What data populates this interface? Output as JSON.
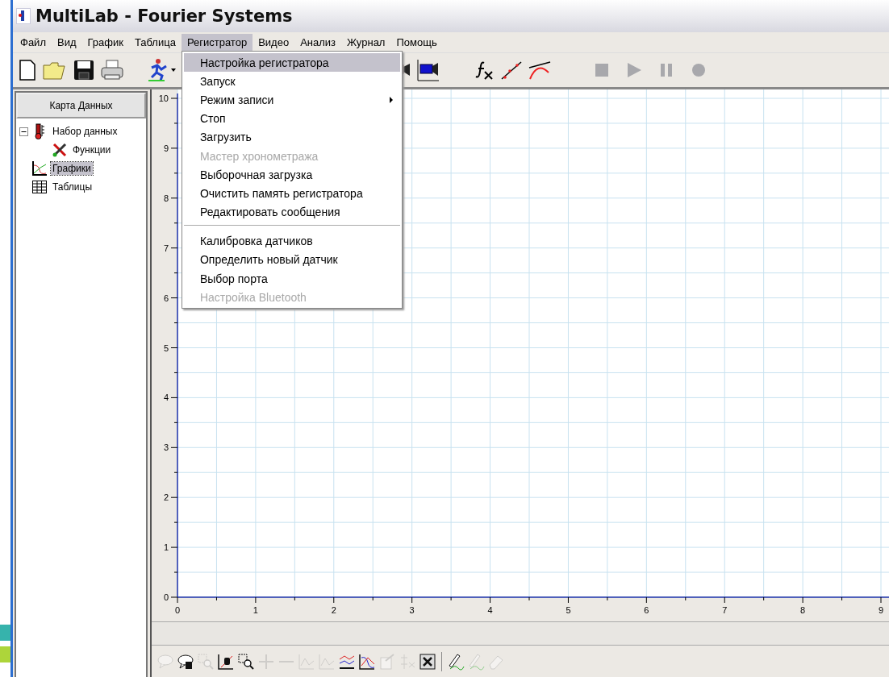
{
  "window": {
    "title": "MultiLab - Fourier Systems"
  },
  "menu_bar": [
    {
      "label": "Файл",
      "selected": false
    },
    {
      "label": "Вид",
      "selected": false
    },
    {
      "label": "График",
      "selected": false
    },
    {
      "label": "Таблица",
      "selected": false
    },
    {
      "label": "Регистратор",
      "selected": true
    },
    {
      "label": "Видео",
      "selected": false
    },
    {
      "label": "Анализ",
      "selected": false
    },
    {
      "label": "Журнал",
      "selected": false
    },
    {
      "label": "Помощь",
      "selected": false
    }
  ],
  "dropdown": [
    {
      "label": "Настройка регистратора",
      "selected": true,
      "disabled": false,
      "submenu": false
    },
    {
      "label": "Запуск",
      "selected": false,
      "disabled": false,
      "submenu": false
    },
    {
      "label": "Режим записи",
      "selected": false,
      "disabled": false,
      "submenu": true
    },
    {
      "label": "Стоп",
      "selected": false,
      "disabled": false,
      "submenu": false
    },
    {
      "label": "Загрузить",
      "selected": false,
      "disabled": false,
      "submenu": false
    },
    {
      "label": "Мастер хронометража",
      "selected": false,
      "disabled": true,
      "submenu": false
    },
    {
      "label": "Выборочная загрузка",
      "selected": false,
      "disabled": false,
      "submenu": false
    },
    {
      "label": "Очистить память регистратора",
      "selected": false,
      "disabled": false,
      "submenu": false
    },
    {
      "label": "Редактировать сообщения",
      "selected": false,
      "disabled": false,
      "submenu": false
    },
    {
      "kind": "separator"
    },
    {
      "label": "Калибровка датчиков",
      "selected": false,
      "disabled": false,
      "submenu": false
    },
    {
      "label": "Определить новый датчик",
      "selected": false,
      "disabled": false,
      "submenu": false
    },
    {
      "label": "Выбор порта",
      "selected": false,
      "disabled": false,
      "submenu": false
    },
    {
      "label": "Настройка Bluetooth",
      "selected": false,
      "disabled": true,
      "submenu": false
    }
  ],
  "transport": [
    {
      "kind": "stop",
      "disabled": true
    },
    {
      "kind": "play",
      "disabled": true
    },
    {
      "kind": "pause",
      "disabled": true
    },
    {
      "kind": "record",
      "disabled": true
    }
  ],
  "sidebar": {
    "header": "Карта Данных",
    "tree": [
      {
        "label": "Набор данных",
        "kind": "dataset",
        "expanded": true,
        "selected": false,
        "children": [
          {
            "label": "Функции",
            "kind": "functions",
            "selected": false
          }
        ]
      },
      {
        "label": "Графики",
        "kind": "graphs",
        "selected": true
      },
      {
        "label": "Таблицы",
        "kind": "tables",
        "selected": false
      }
    ]
  },
  "graph": {
    "chart_data": {
      "type": "line",
      "grid": true,
      "xlim": [
        0,
        9
      ],
      "ylim": [
        0,
        10
      ],
      "xticks": [
        0,
        1,
        2,
        3,
        4,
        5,
        6,
        7,
        8,
        9
      ],
      "yticks": [
        0,
        1,
        2,
        3,
        4,
        5,
        6,
        7,
        8,
        9,
        10
      ]
    }
  },
  "bottom_toolbar": [
    {
      "kind": "text",
      "disabled": true
    },
    {
      "kind": "text-hand",
      "disabled": false
    },
    {
      "kind": "zoom-fit",
      "disabled": true
    },
    {
      "kind": "pan",
      "disabled": false
    },
    {
      "kind": "zoom",
      "disabled": false
    },
    {
      "kind": "plus",
      "disabled": true
    },
    {
      "kind": "minus",
      "disabled": true
    },
    {
      "kind": "curve",
      "disabled": true
    },
    {
      "kind": "curve2",
      "disabled": true
    },
    {
      "kind": "multi",
      "disabled": false
    },
    {
      "kind": "overlay",
      "disabled": false
    },
    {
      "kind": "props",
      "disabled": true
    },
    {
      "kind": "axis",
      "disabled": true
    },
    {
      "kind": "excel",
      "disabled": false
    },
    {
      "kind": "sep"
    },
    {
      "kind": "pen",
      "disabled": false
    },
    {
      "kind": "pen2",
      "disabled": true
    },
    {
      "kind": "eraser",
      "disabled": true
    }
  ]
}
